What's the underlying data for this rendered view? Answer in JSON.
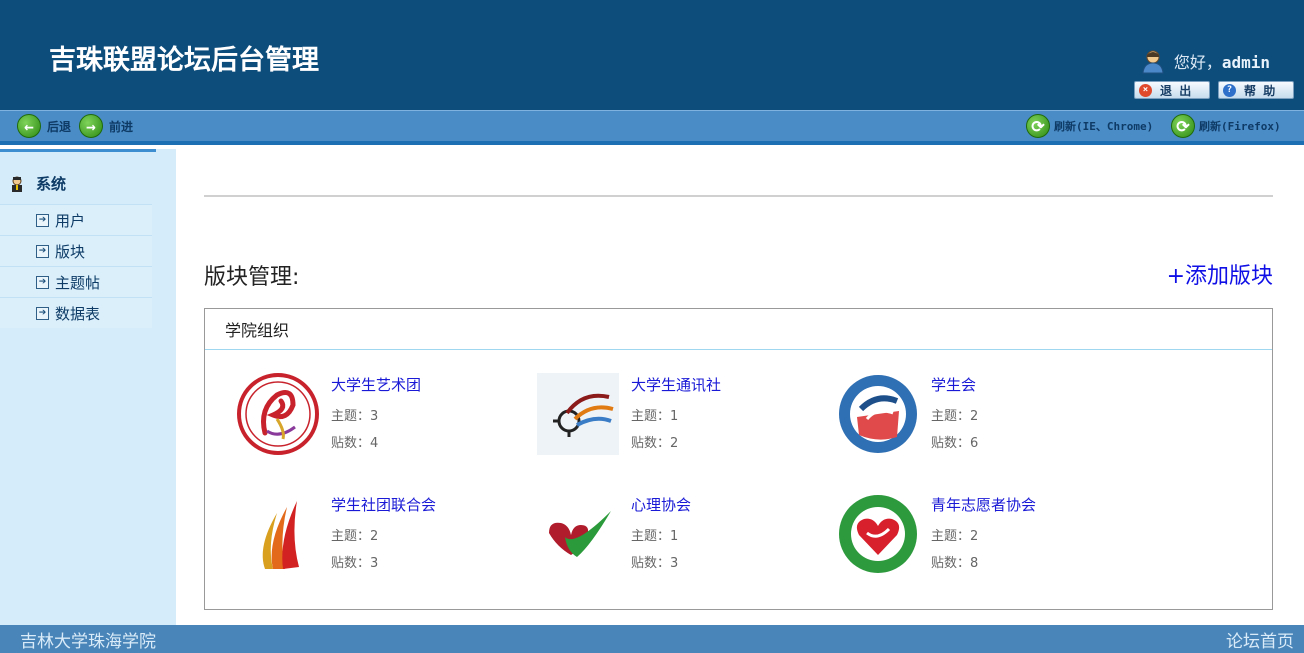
{
  "header": {
    "title": "吉珠联盟论坛后台管理",
    "greeting": "您好，",
    "username": "admin",
    "logout_label": "退 出",
    "help_label": "帮 助"
  },
  "nav": {
    "back_label": "后退",
    "forward_label": "前进",
    "refresh_ie_label": "刷新(IE、Chrome)",
    "refresh_ff_label": "刷新(Firefox)"
  },
  "sidebar": {
    "heading": "系统",
    "items": [
      {
        "label": "用户"
      },
      {
        "label": "版块"
      },
      {
        "label": "主题帖"
      },
      {
        "label": "数据表"
      }
    ]
  },
  "main": {
    "title": "版块管理:",
    "add_label": "+添加版块",
    "category": "学院组织",
    "boards": [
      {
        "name": "大学生艺术团",
        "topics": "主题：3",
        "posts": "贴数：4"
      },
      {
        "name": "大学生通讯社",
        "topics": "主题：1",
        "posts": "贴数：2"
      },
      {
        "name": "学生会",
        "topics": "主题：2",
        "posts": "贴数：6"
      },
      {
        "name": "学生社团联合会",
        "topics": "主题：2",
        "posts": "贴数：3"
      },
      {
        "name": "心理协会",
        "topics": "主题：1",
        "posts": "贴数：3"
      },
      {
        "name": "青年志愿者协会",
        "topics": "主题：2",
        "posts": "贴数：8"
      }
    ]
  },
  "footer": {
    "left": "吉林大学珠海学院",
    "right": "论坛首页"
  },
  "colors": {
    "header_bg": "#0d4d7c",
    "navbar_bg": "#4a8cc6",
    "sidebar_bg": "#d5ecfa",
    "link": "#1a1ad6"
  }
}
